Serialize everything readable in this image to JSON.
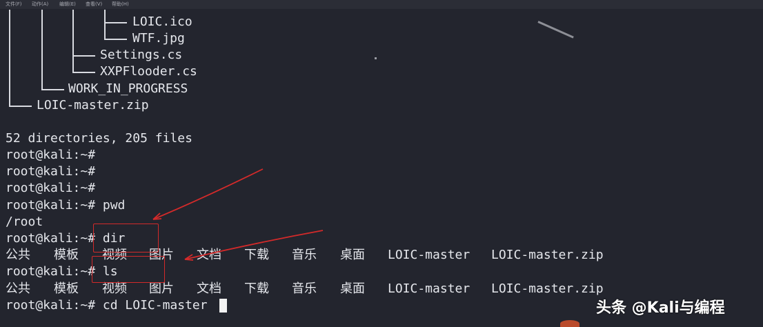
{
  "menu": [
    "文件(F)",
    "动作(A)",
    "编辑(E)",
    "查看(V)",
    "帮助(H)"
  ],
  "tree": {
    "items": [
      "LOIC.ico",
      "WTF.jpg",
      "Settings.cs",
      "XXPFlooder.cs",
      "WORK_IN_PROGRESS",
      "LOIC-master.zip"
    ]
  },
  "terminal": {
    "summary": "52 directories, 205 files",
    "prompts": [
      "root@kali:~#",
      "root@kali:~#",
      "root@kali:~#",
      "root@kali:~# pwd"
    ],
    "pwd_output": "/root",
    "dir_cmd": "root@kali:~# dir",
    "ls_cmd": "root@kali:~# ls",
    "cd_cmd": "root@kali:~# cd LOIC-master",
    "dir_listing": [
      "公共",
      "模板",
      "视频",
      "图片",
      "文档",
      "下载",
      "音乐",
      "桌面",
      "LOIC-master",
      "LOIC-master.zip"
    ],
    "ls_listing": [
      "公共",
      "模板",
      "视频",
      "图片",
      "文档",
      "下载",
      "音乐",
      "桌面",
      "LOIC-master",
      "LOIC-master.zip"
    ]
  },
  "watermark": "头条 @Kali与编程",
  "colors": {
    "background": "#23252e",
    "text": "#e5e7ec",
    "annotation": "#d42a2a"
  }
}
